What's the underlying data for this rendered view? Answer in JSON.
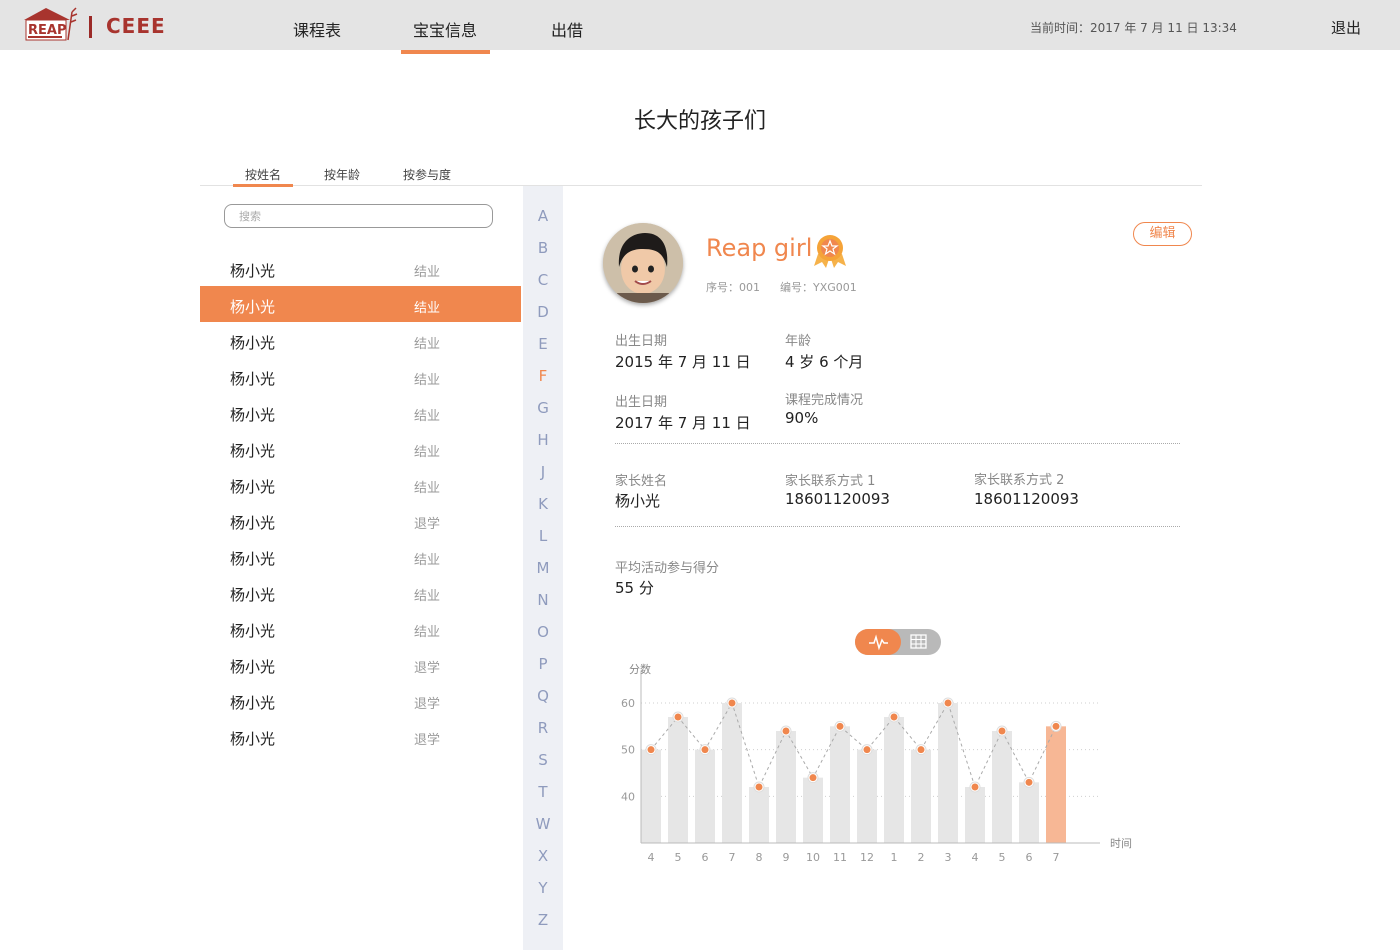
{
  "header": {
    "logo_text": "REAP",
    "brand": "CEEE",
    "nav": [
      {
        "label": "课程表"
      },
      {
        "label": "宝宝信息"
      },
      {
        "label": "出借"
      }
    ],
    "active_nav": 1,
    "clock": "当前时间：2017 年 7 月 11 日 13:34",
    "logout": "退出"
  },
  "page_title": "长大的孩子们",
  "sort_tabs": [
    {
      "label": "按姓名"
    },
    {
      "label": "按年龄"
    },
    {
      "label": "按参与度"
    }
  ],
  "active_sort": 0,
  "search": {
    "placeholder": "搜索",
    "value": ""
  },
  "students": [
    {
      "name": "杨小光",
      "status": "结业"
    },
    {
      "name": "杨小光",
      "status": "结业"
    },
    {
      "name": "杨小光",
      "status": "结业"
    },
    {
      "name": "杨小光",
      "status": "结业"
    },
    {
      "name": "杨小光",
      "status": "结业"
    },
    {
      "name": "杨小光",
      "status": "结业"
    },
    {
      "name": "杨小光",
      "status": "结业"
    },
    {
      "name": "杨小光",
      "status": "退学"
    },
    {
      "name": "杨小光",
      "status": "结业"
    },
    {
      "name": "杨小光",
      "status": "结业"
    },
    {
      "name": "杨小光",
      "status": "结业"
    },
    {
      "name": "杨小光",
      "status": "退学"
    },
    {
      "name": "杨小光",
      "status": "退学"
    },
    {
      "name": "杨小光",
      "status": "退学"
    }
  ],
  "selected_student": 1,
  "alphabet": [
    "A",
    "B",
    "C",
    "D",
    "E",
    "F",
    "G",
    "H",
    "J",
    "K",
    "L",
    "M",
    "N",
    "O",
    "P",
    "Q",
    "R",
    "S",
    "T",
    "W",
    "X",
    "Y",
    "Z"
  ],
  "active_letter": "F",
  "profile": {
    "name": "Reap girl",
    "seq": "序号：001",
    "code": "编号：YXG001",
    "edit_label": "编辑",
    "birth_label": "出生日期",
    "birth_value": "2015 年 7 月 11 日",
    "age_label": "年龄",
    "age_value": "4 岁 6 个月",
    "birth2_label": "出生日期",
    "birth2_value": "2017 年 7 月 11 日",
    "completion_label": "课程完成情况",
    "completion_value": "90%",
    "parent_label": "家长姓名",
    "parent_value": "杨小光",
    "contact1_label": "家长联系方式 1",
    "contact1_value": "18601120093",
    "contact2_label": "家长联系方式 2",
    "contact2_value": "18601120093",
    "avg_label": "平均活动参与得分",
    "avg_value": "55 分"
  },
  "icons": {
    "line_chart_toggle": "pulse-icon",
    "table_toggle": "grid-icon",
    "medal": "medal-star-icon"
  },
  "colors": {
    "accent": "#f0874e",
    "bar": "#e6e6e6",
    "bar_highlight": "#f7b795",
    "alpha": "#8f9bbd"
  },
  "chart_data": {
    "type": "bar",
    "ylabel": "分数",
    "xlabel": "时间",
    "categories": [
      "4",
      "5",
      "6",
      "7",
      "8",
      "9",
      "10",
      "11",
      "12",
      "1",
      "2",
      "3",
      "4",
      "5",
      "6",
      "7"
    ],
    "values": [
      50,
      57,
      50,
      60,
      42,
      54,
      44,
      55,
      50,
      57,
      50,
      60,
      42,
      54,
      43,
      55
    ],
    "highlight_index": 15,
    "yticks": [
      40,
      50,
      60
    ],
    "ylim": [
      30,
      66
    ],
    "overlay": "line-with-points",
    "grid": "dotted"
  }
}
